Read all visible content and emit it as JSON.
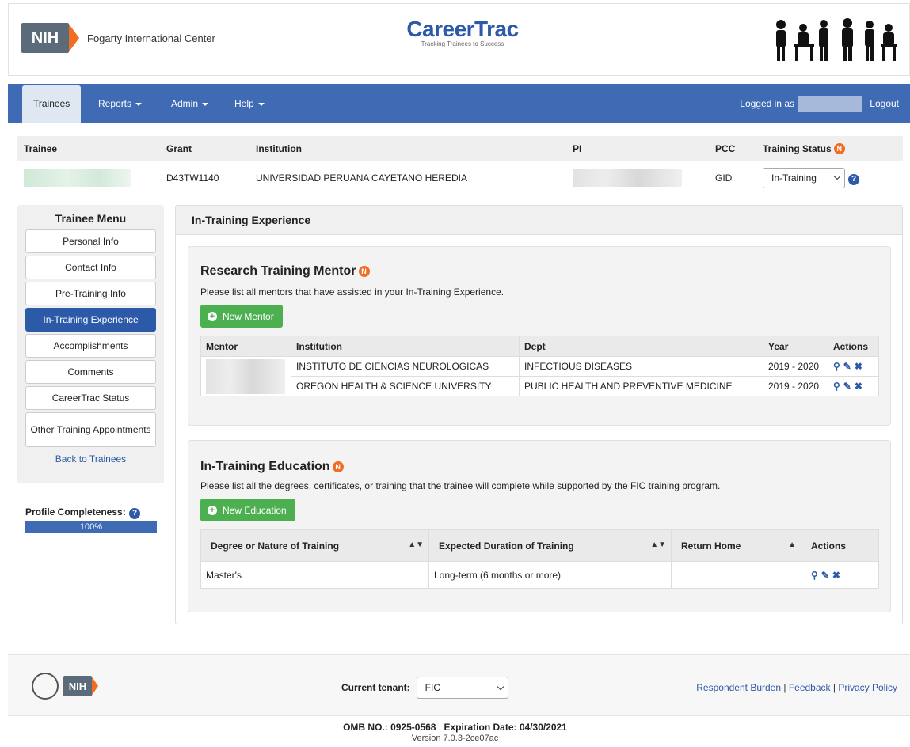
{
  "header": {
    "nih_label": "NIH",
    "fic_name": "Fogarty International Center",
    "app_title": "CareerTrac",
    "app_subtitle": "Tracking Trainees to Success"
  },
  "nav": {
    "items": [
      "Trainees",
      "Reports",
      "Admin",
      "Help"
    ],
    "logged_in_label": "Logged in as",
    "logout_label": "Logout"
  },
  "trainee_info": {
    "headers": [
      "Trainee",
      "Grant",
      "Institution",
      "PI",
      "PCC",
      "Training Status"
    ],
    "grant": "D43TW1140",
    "institution": "UNIVERSIDAD PERUANA CAYETANO HEREDIA",
    "pcc": "GID",
    "status_value": "In-Training",
    "badge": "N",
    "help": "?"
  },
  "side_menu": {
    "title": "Trainee Menu",
    "items": [
      "Personal Info",
      "Contact Info",
      "Pre-Training Info",
      "In-Training Experience",
      "Accomplishments",
      "Comments",
      "CareerTrac Status",
      "Other Training Appointments"
    ],
    "active": "In-Training Experience",
    "back_label": "Back to Trainees"
  },
  "profile": {
    "label": "Profile Completeness:",
    "value": "100%",
    "progress": 1.0
  },
  "main": {
    "title": "In-Training Experience",
    "mentor_section": {
      "title": "Research Training Mentor",
      "description": "Please list all mentors that have assisted in your In-Training Experience.",
      "button": "New Mentor",
      "headers": [
        "Mentor",
        "Institution",
        "Dept",
        "Year",
        "Actions"
      ],
      "rows": [
        {
          "institution": "INSTITUTO DE CIENCIAS NEUROLOGICAS",
          "dept": "INFECTIOUS DISEASES",
          "year": "2019 - 2020"
        },
        {
          "institution": "OREGON HEALTH & SCIENCE UNIVERSITY",
          "dept": "PUBLIC HEALTH AND PREVENTIVE MEDICINE",
          "year": "2019 - 2020"
        }
      ]
    },
    "education_section": {
      "title": "In-Training Education",
      "description": "Please list all the degrees, certificates, or training that the trainee will complete while supported by the FIC training program.",
      "button": "New Education",
      "headers": [
        "Degree or Nature of Training",
        "Expected Duration of Training",
        "Return Home",
        "Actions"
      ],
      "rows": [
        {
          "degree": "Master's",
          "duration": "Long-term (6 months or more)",
          "return_home": ""
        }
      ]
    }
  },
  "footer": {
    "nih_label": "NIH",
    "tenant_label": "Current tenant:",
    "tenant_value": "FIC",
    "links": [
      "Respondent Burden",
      "Feedback",
      "Privacy Policy"
    ],
    "omb": "OMB NO.: 0925-0568",
    "expiration": "Expiration Date: 04/30/2021",
    "version": "Version 7.0.3-2ce07ac"
  },
  "icons": {
    "view": "magnifier-icon",
    "edit": "pencil-icon",
    "delete": "x-icon"
  },
  "colors": {
    "nav_blue": "#3f6bb4",
    "primary_blue": "#2d5aa8",
    "accent_orange": "#f26c22",
    "button_green": "#4caf50"
  }
}
